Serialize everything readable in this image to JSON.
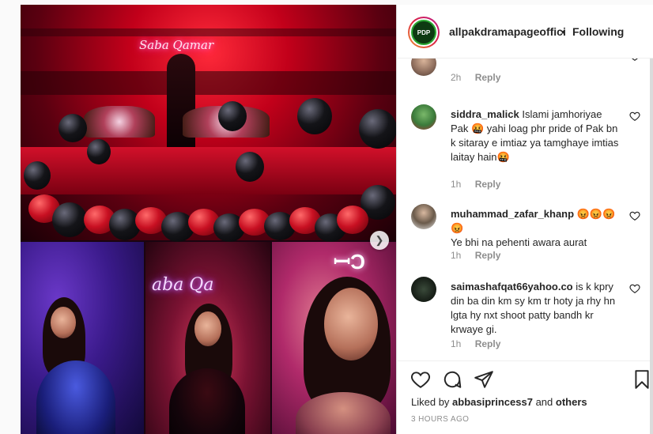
{
  "post": {
    "neon_sign_text": "Saba Qamar",
    "neon_sign_small": "aba Qa"
  },
  "header": {
    "avatar_text": "PDP",
    "username": "allpakdramapageoffici",
    "separator": "•",
    "follow_status": "Following"
  },
  "comments": [
    {
      "username": "",
      "text": "",
      "time": "2h",
      "reply": "Reply"
    },
    {
      "username": "siddra_malick",
      "text": "Islami jamhoriyae Pak 🤬 yahi loag phr pride of Pak bn k sitaray e imtiaz ya tamghaye imtias laitay hain🤬",
      "time": "1h",
      "reply": "Reply"
    },
    {
      "username": "muhammad_zafar_khanp",
      "text": "Ye bhi na pehenti awara aurat",
      "time": "1h",
      "reply": "Reply",
      "emoji_suffix": "😡😡😡😡"
    },
    {
      "username": "saimashafqat66yahoo.co",
      "text": "is k kpry din ba din km sy km tr hoty ja rhy hn lgta hy nxt shoot patty bandh kr krwaye gi.",
      "time": "1h",
      "reply": "Reply"
    }
  ],
  "footer": {
    "liked_by_prefix": "Liked by",
    "liked_by_user": "abbasiprincess7",
    "liked_by_and": "and",
    "liked_by_others": "others",
    "time_ago": "3 HOURS AGO"
  },
  "icons": {
    "heart": "heart-icon",
    "comment": "comment-icon",
    "share": "share-icon",
    "save": "bookmark-icon",
    "next": "chevron-right-icon"
  }
}
